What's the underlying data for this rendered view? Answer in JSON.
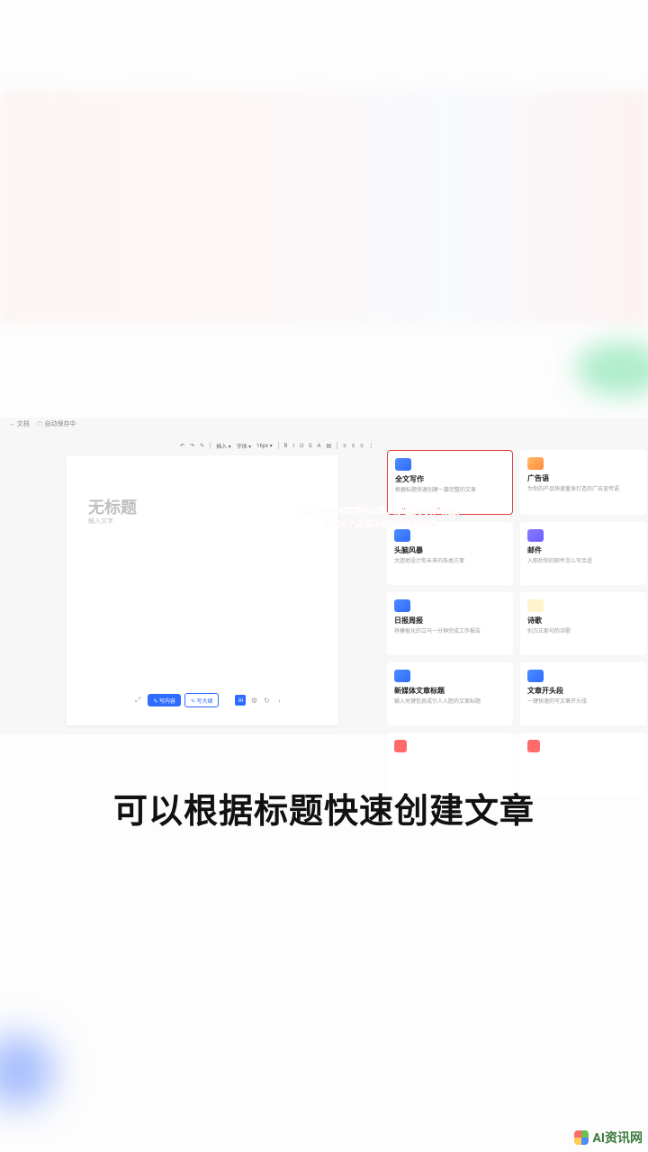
{
  "topbar": {
    "back_label": "← 文档",
    "save_status": "☁ 自动保存中"
  },
  "toolbar": {
    "items": [
      "↶",
      "↷",
      "✎",
      "插入 ▾",
      "字体 ▾",
      "16px ▾",
      "B",
      "I",
      "U",
      "S",
      "A",
      "▤",
      "≡",
      "≡",
      "≡",
      "⋮"
    ]
  },
  "document": {
    "title_placeholder": "无标题",
    "body_placeholder": "输入文字"
  },
  "bottombar": {
    "btn1": "✎ 写内容",
    "btn2": "✎ 写大纲",
    "sq": "AI"
  },
  "cards": [
    {
      "icon": "ic-blue",
      "title": "全文写作",
      "desc": "根据标题快速创建一篇完整的文章",
      "selected": true
    },
    {
      "icon": "ic-orange",
      "title": "广告语",
      "desc": "为你的产品快速量身打造的广告宣传语"
    },
    {
      "icon": "ic-blue",
      "title": "头脑风暴",
      "desc": "大胆地设计你未来的各类方案"
    },
    {
      "icon": "ic-purple",
      "title": "邮件",
      "desc": "入职后你的邮件怎么写合适"
    },
    {
      "icon": "ic-blue",
      "title": "日报周报",
      "desc": "将模板化的立马一分钟完成工作报告"
    },
    {
      "icon": "ic-yellow",
      "title": "诗歌",
      "desc": "别方正那句的诗歌"
    },
    {
      "icon": "ic-blue",
      "title": "新媒体文章标题",
      "desc": "输入关键信息成引人入胜的文案标题"
    },
    {
      "icon": "ic-blue",
      "title": "文章开头段",
      "desc": "一键快速的写文章开头段"
    },
    {
      "icon": "ic-red",
      "title": "",
      "desc": ""
    },
    {
      "icon": "ic-red",
      "title": "",
      "desc": ""
    }
  ],
  "annotation": {
    "line1": "在右侧中找到需要的功能，即\"全文写作\"功能，",
    "line2": "这里可以根据标题快速创建文章"
  },
  "caption": "可以根据标题快速创建文章",
  "watermark": "AI资讯网"
}
